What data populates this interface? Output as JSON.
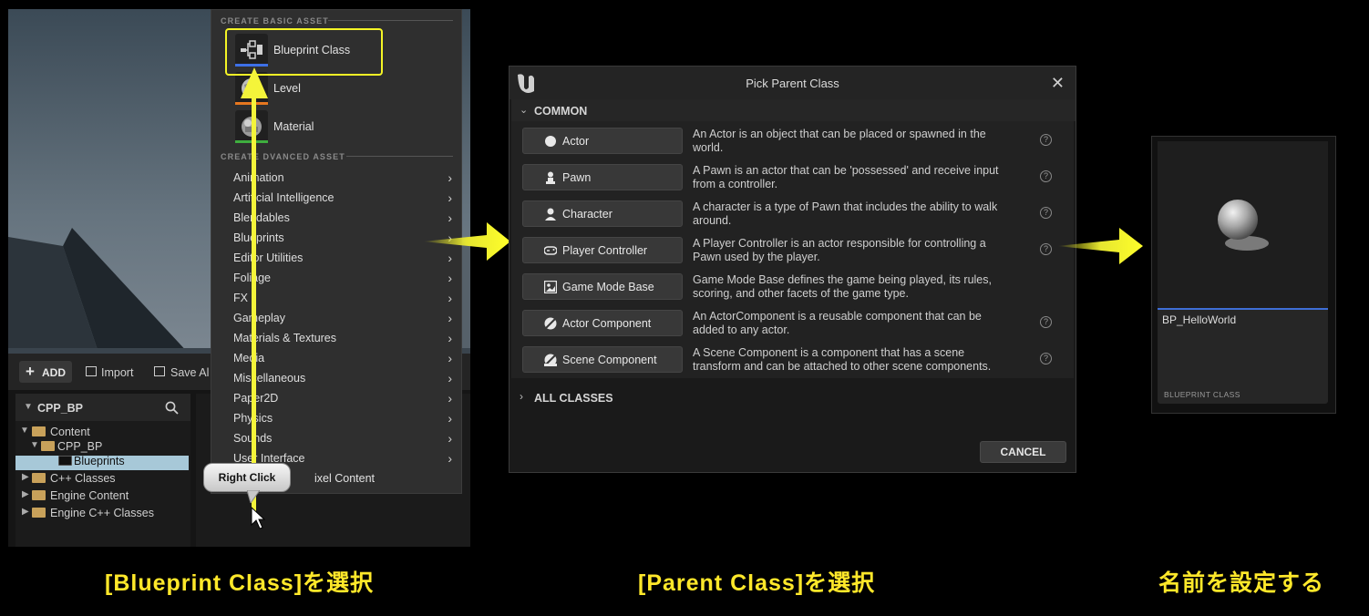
{
  "panel1": {
    "toolbar": {
      "add_label": "ADD",
      "import_label": "Import",
      "save_label": "Save Al"
    },
    "sources": {
      "header": "CPP_BP",
      "tree": [
        "Content",
        "CPP_BP",
        "Blueprints",
        "C++ Classes",
        "Engine Content",
        "Engine C++ Classes"
      ]
    },
    "menu": {
      "basic_header": "CREATE BASIC ASSET",
      "advanced_header": "CREATE ADVANCED ASSET",
      "advanced_header_visible": "CREATE   DVANCED ASSET",
      "basic_items": [
        "Blueprint Class",
        "Level",
        "Material"
      ],
      "advanced_items": [
        "Animation",
        "Artificial Intelligence",
        "Blendables",
        "Blueprints",
        "Editor Utilities",
        "Foliage",
        "FX",
        "Gameplay",
        "Materials & Textures",
        "Media",
        "Miscellaneous",
        "Paper2D",
        "Physics",
        "Sounds",
        "User Interface"
      ],
      "partial_item": "ixel Content"
    },
    "callout": "Right Click",
    "caption": "[Blueprint Class]を選択"
  },
  "dialog": {
    "title": "Pick Parent Class",
    "common_label": "COMMON",
    "all_classes_label": "ALL CLASSES",
    "cancel_label": "CANCEL",
    "classes": [
      {
        "name": "Actor",
        "desc1": "An Actor is an object that can be placed or spawned in the",
        "desc2": "world.",
        "icon": "actor-icon"
      },
      {
        "name": "Pawn",
        "desc1": "A Pawn is an actor that can be 'possessed' and receive input",
        "desc2": "from a controller.",
        "icon": "pawn-icon"
      },
      {
        "name": "Character",
        "desc1": "A character is a type of Pawn that includes the ability to walk",
        "desc2": "around.",
        "icon": "character-icon"
      },
      {
        "name": "Player Controller",
        "desc1": "A Player Controller is an actor responsible for controlling a",
        "desc2": "Pawn used by the player.",
        "icon": "gamepad-icon"
      },
      {
        "name": "Game Mode Base",
        "desc1": "Game Mode Base defines the game being played, its rules,",
        "desc2": "scoring, and other facets of the game type.",
        "icon": "game-mode-icon"
      },
      {
        "name": "Actor Component",
        "desc1": "An ActorComponent is a reusable component that can be",
        "desc2": "added to any actor.",
        "icon": "component-icon"
      },
      {
        "name": "Scene Component",
        "desc1": "A Scene Component is a component that has a scene",
        "desc2": "transform and can be attached to other scene components.",
        "icon": "scene-component-icon"
      }
    ],
    "caption": "[Parent Class]を選択"
  },
  "tile": {
    "name": "BP_HelloWorld",
    "type": "BLUEPRINT CLASS",
    "caption": "名前を設定する"
  },
  "colors": {
    "highlight": "#f5f526",
    "caption": "#ffe82a",
    "selection": "#3e6ed6"
  }
}
